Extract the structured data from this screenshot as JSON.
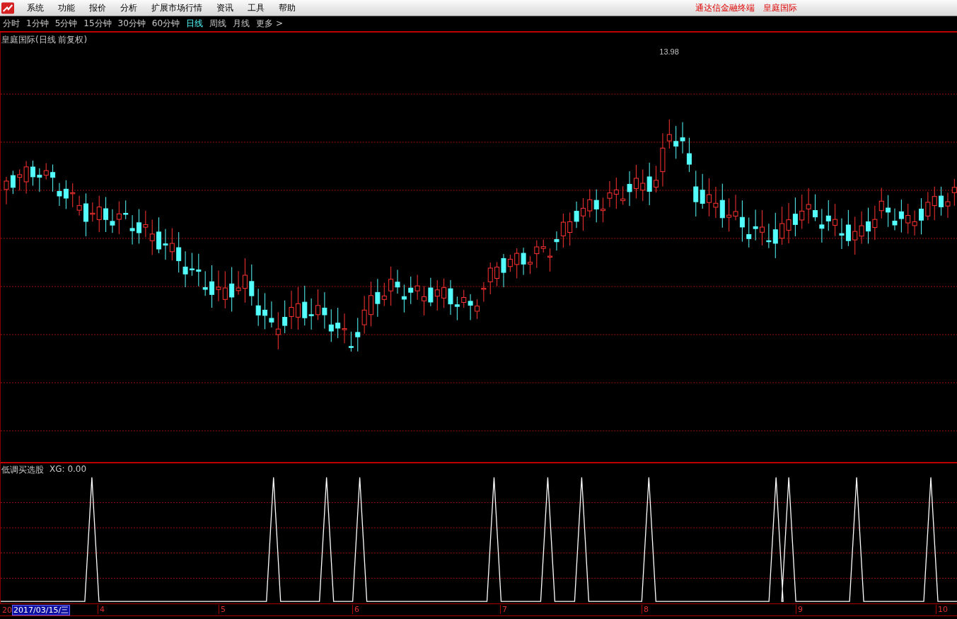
{
  "menu": {
    "items": [
      "系统",
      "功能",
      "报价",
      "分析",
      "扩展市场行情",
      "资讯",
      "工具",
      "帮助"
    ],
    "app_title": "通达信金融终端",
    "stock_title": "皇庭国际"
  },
  "periods": [
    {
      "label": "分时",
      "selected": false
    },
    {
      "label": "1分钟",
      "selected": false
    },
    {
      "label": "5分钟",
      "selected": false
    },
    {
      "label": "15分钟",
      "selected": false
    },
    {
      "label": "30分钟",
      "selected": false
    },
    {
      "label": "60分钟",
      "selected": false
    },
    {
      "label": "日线",
      "selected": true
    },
    {
      "label": "周线",
      "selected": false
    },
    {
      "label": "月线",
      "selected": false
    },
    {
      "label": "更多 >",
      "selected": false
    }
  ],
  "main_chart": {
    "title": "皇庭国际(日线 前复权)",
    "peak_label": "13.98"
  },
  "indicator": {
    "name": "低调买选股",
    "reading": "XG: 0.00"
  },
  "axis": {
    "year_prefix": "20",
    "cursor_date": "2017/03/15/三",
    "months": [
      "4",
      "5",
      "6",
      "7",
      "8",
      "9",
      "10"
    ]
  }
}
